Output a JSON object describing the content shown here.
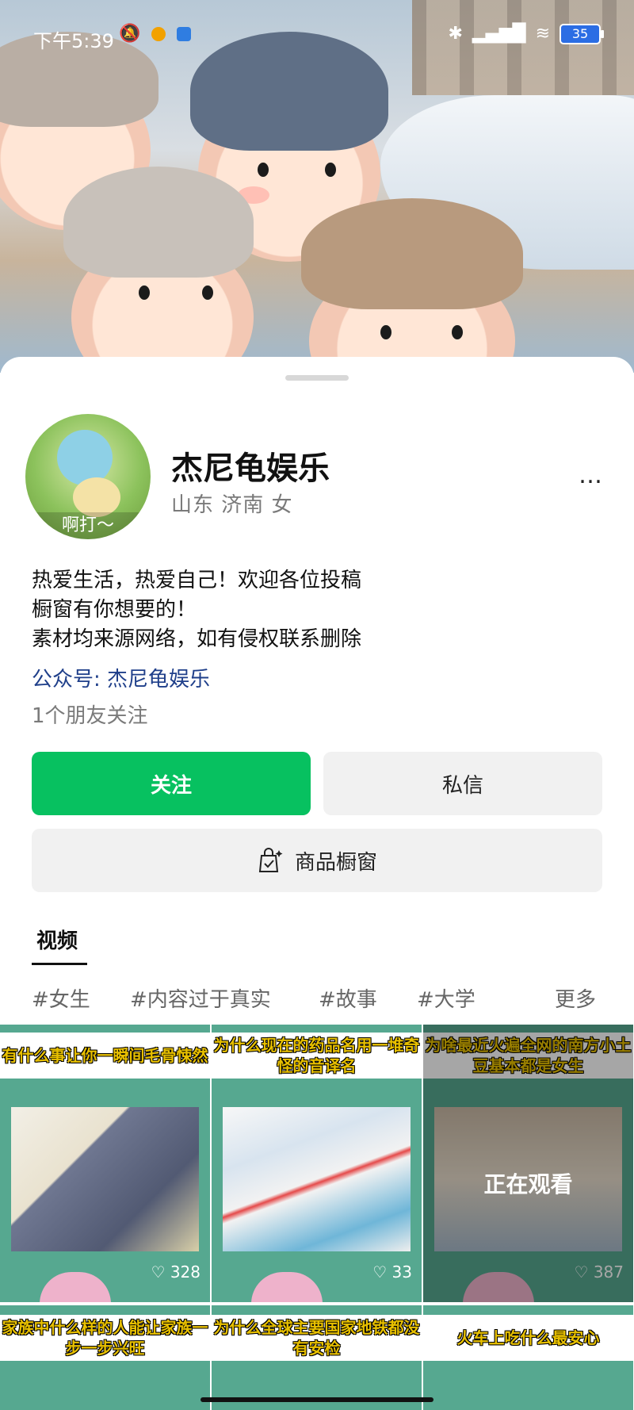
{
  "status_bar": {
    "time": "下午5:39",
    "battery": "35",
    "icons": [
      "mute-bell-icon",
      "app-icon",
      "app-icon",
      "bluetooth-icon",
      "hd-signal-icon",
      "wifi-icon",
      "battery-icon"
    ]
  },
  "profile": {
    "name": "杰尼龟娱乐",
    "meta": "山东 济南 女",
    "avatar_caption": "啊打～",
    "bio_lines": [
      "热爱生活，热爱自己！欢迎各位投稿",
      "橱窗有你想要的！",
      "素材均来源网络，如有侵权联系删除"
    ],
    "official_account": "公众号: 杰尼龟娱乐",
    "friends_follow": "1个朋友关注",
    "more": "…"
  },
  "actions": {
    "follow": "关注",
    "message": "私信",
    "shop": "商品橱窗"
  },
  "tabs": {
    "video": "视频"
  },
  "tags": [
    "#女生",
    "#内容过于真实",
    "#故事",
    "#大学"
  ],
  "tags_more": "更多",
  "videos": [
    {
      "title": "有什么事让你一瞬间毛骨悚然",
      "likes": "328",
      "watching": ""
    },
    {
      "title": "为什么现在的药品名用一堆奇怪的音译名",
      "likes": "33",
      "watching": ""
    },
    {
      "title": "为啥最近火遍全网的南方小土豆基本都是女生",
      "likes": "387",
      "watching": "正在观看"
    },
    {
      "title": "家族中什么样的人能让家族一步一步兴旺",
      "likes": "",
      "watching": ""
    },
    {
      "title": "为什么全球主要国家地铁都没有安检",
      "likes": "",
      "watching": ""
    },
    {
      "title": "火车上吃什么最安心",
      "likes": "",
      "watching": ""
    }
  ],
  "colors": {
    "follow_green": "#07c160",
    "link_blue": "#1f3f8a"
  }
}
